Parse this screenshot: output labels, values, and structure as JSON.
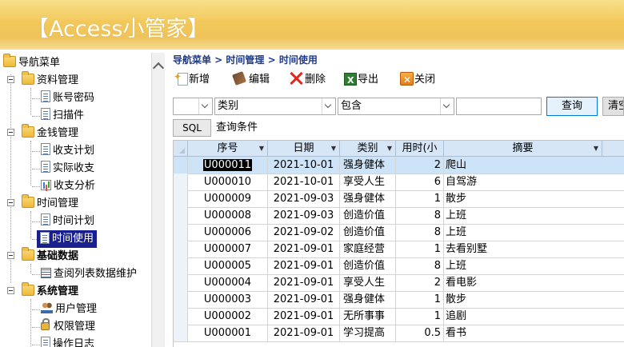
{
  "app": {
    "title": "【Access小管家】"
  },
  "nav": {
    "root": "导航菜单",
    "groups": [
      {
        "label": "资料管理",
        "items": [
          "账号密码",
          "扫描件"
        ]
      },
      {
        "label": "金钱管理",
        "items": [
          "收支计划",
          "实际收支",
          "收支分析"
        ]
      },
      {
        "label": "时间管理",
        "items": [
          "时间计划",
          "时间使用"
        ]
      },
      {
        "label": "基础数据",
        "items": [
          "查阅列表数据维护"
        ]
      },
      {
        "label": "系统管理",
        "items": [
          "用户管理",
          "权限管理",
          "操作日志"
        ]
      }
    ],
    "selected": "时间使用"
  },
  "breadcrumb": "导航菜单 > 时间管理 > 时间使用",
  "toolbar": {
    "new": "新增",
    "edit": "编辑",
    "delete": "删除",
    "export": "导出",
    "close": "关闭"
  },
  "filter": {
    "field_value": "类别",
    "operator_value": "包含",
    "keyword_value": "",
    "query_label": "查询",
    "clear_label": "清空",
    "sql_label": "SQL",
    "condition_label": "查询条件"
  },
  "grid": {
    "columns": [
      "序号",
      "日期",
      "类别",
      "用时(小",
      "摘要"
    ],
    "rows": [
      {
        "no": "U000011",
        "date": "2021-10-01",
        "cat": "强身健体",
        "hrs": "2",
        "sum": "爬山"
      },
      {
        "no": "U000010",
        "date": "2021-10-01",
        "cat": "享受人生",
        "hrs": "6",
        "sum": "自驾游"
      },
      {
        "no": "U000009",
        "date": "2021-09-03",
        "cat": "强身健体",
        "hrs": "1",
        "sum": "散步"
      },
      {
        "no": "U000008",
        "date": "2021-09-03",
        "cat": "创造价值",
        "hrs": "8",
        "sum": "上班"
      },
      {
        "no": "U000006",
        "date": "2021-09-02",
        "cat": "创造价值",
        "hrs": "8",
        "sum": "上班"
      },
      {
        "no": "U000007",
        "date": "2021-09-01",
        "cat": "家庭经营",
        "hrs": "1",
        "sum": "去看别墅"
      },
      {
        "no": "U000005",
        "date": "2021-09-01",
        "cat": "创造价值",
        "hrs": "8",
        "sum": "上班"
      },
      {
        "no": "U000004",
        "date": "2021-09-01",
        "cat": "享受人生",
        "hrs": "2",
        "sum": "看电影"
      },
      {
        "no": "U000003",
        "date": "2021-09-01",
        "cat": "强身健体",
        "hrs": "1",
        "sum": "散步"
      },
      {
        "no": "U000002",
        "date": "2021-09-01",
        "cat": "无所事事",
        "hrs": "1",
        "sum": "追剧"
      },
      {
        "no": "U000001",
        "date": "2021-09-01",
        "cat": "学习提高",
        "hrs": "0.5",
        "sum": "看书"
      }
    ]
  },
  "colors": {
    "banner": "#f3c85a",
    "header_text": "#1e3a8a",
    "grid_header": "#d6e6f7",
    "selection": "#1a1f8f"
  }
}
